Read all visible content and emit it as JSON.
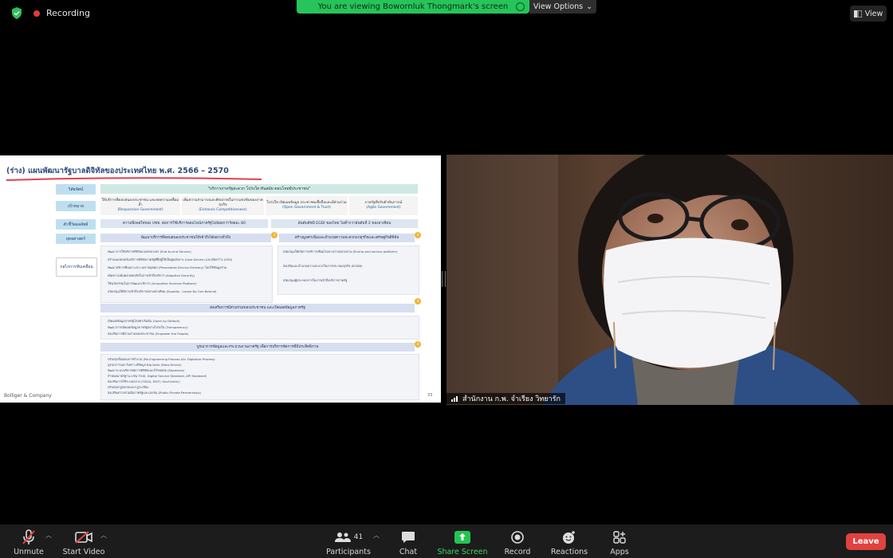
{
  "top": {
    "recording_label": "Recording",
    "banner_text": "You are viewing Bowornluk Thongmark's screen",
    "view_options_label": "View Options",
    "view_label": "View"
  },
  "slide": {
    "title": "(ร่าง) แผนพัฒนารัฐบาลดิจิทัลของประเทศไทย พ.ศ. 2566 – 2570",
    "labels": [
      "วิสัยทัศน์",
      "เป้าหมาย",
      "ตัวชี้วัดผลลัพธ์",
      "ยุทธศาสตร์",
      "กลไกการขับเคลื่อน"
    ],
    "vision": "\"บริการภาครัฐสะดวก โปร่งใส ทันสมัย ตอบโจทย์ประชาชน\"",
    "goals": [
      {
        "text": "ให้บริการที่ตอบสนองประชาชน และลดความเหลื่อมล้ำ",
        "en": "(Responsive Government)"
      },
      {
        "text": "เพิ่มความสามารถและศักยภาพในการแข่งขันของภาคธุรกิจ",
        "en": "(Enhance Competitiveness)"
      },
      {
        "text": "โปร่งใส เปิดเผยข้อมูล ประชาชนเชื่อถือและมีส่วนร่วม",
        "en": "(Open Government & Trust)"
      },
      {
        "text": "ภาครัฐที่ปรับตัวทันการณ์",
        "en": "(Agile Government)"
      }
    ],
    "indicators": [
      "ความพึงพอใจของ ปชช. ต่อการใช้บริการออนไลน์ภาครัฐไม่น้อยกว่าร้อยละ 80",
      "อันดับดัชนี EGDI ของไทย ไม่ต่ำกว่าอันดับที่ 2 ของอาเซียน"
    ],
    "strategies": [
      "พัฒนาบริการที่ตอบสนองประชาชนให้เข้าถึงได้อย่างทั่วถึง",
      "สร้างมูลค่าเพิ่มและอำนวยความสะดวกแก่ธุรกิจและเศรษฐกิจดิจิทัล",
      "ส่งเสริมการมีส่วนร่วมของประชาชน และเปิดเผยข้อมูลภาครัฐ",
      "บูรณาการข้อมูลและกระบวนงานภาครัฐ เพื่อการบริหารจัดการที่มีประสิทธิภาพ"
    ],
    "strategy_numbers": [
      "1",
      "2",
      "3",
      "4"
    ],
    "bullets": {
      "s1": [
        "พัฒนาการให้บริการดิจิทัลแบบครบวงจร (End-to-end Service)",
        "สร้างแพลตฟอร์มบริการดิจิทัลภาครัฐที่ยึดผู้ใช้เป็นศูนย์กลาง (User-Driven) และเปิดกว้าง (OSS)",
        "พัฒนาบริการที่เฉพาะเจาะจงรายบุคคล (Personalize Service Delivery) โดยใช้ข้อมูลร่วม",
        "เพิ่มความมั่นคงปลอดภัยในการเข้าถึงบริการ (Adaptive Security)",
        "ใช้นวัตกรรมในการพัฒนาบริการ (Innovative Services Platform)",
        "สนับสนุนให้มีการเข้าถึงบริการอย่างเท่าเทียม (Equality : Leave No One Behind)"
      ],
      "s2": [
        "สนับสนุนให้เกิดการบริการเชื่อมโยงระหว่างหน่วยงาน (End-to-end service platform)",
        "ส่งเสริมและอำนวยความสะดวกในการประกอบธุรกิจ (EODB)",
        "สนับสนุนผู้ประกอบการในการเข้าถึงบริการภาครัฐ"
      ],
      "s3": [
        "เปิดเผยข้อมูลภาครัฐโดยค่าเริ่มต้น (Open by Default)",
        "พัฒนาการเปิดเผยข้อมูลภาครัฐอย่างโปร่งใส (Transparency)",
        "ส่งเสริมการมีส่วนร่วมของประชาชน (Empower the People)"
      ],
      "s4": [
        "ปรับปรุงขั้นตอนการทำงาน (Re-Engineering Process และ Digitalize Process)",
        "บูรณาการและวิเคราะห์ข้อมูล Big Data (Data-Driven)",
        "พัฒนาระบบบริหารจัดการดิจิทัลแบบไร้รอยต่อ (Seamless)",
        "กำหนดมาตรฐาน (เช่น TGIX, Digital Service Standard, API Standard)",
        "ส่งเสริมการใช้ระบบกลาง (TDGA, DGFI, GovCentric)",
        "ปรับปรุงกฎหมายและกฎระเบียบ",
        "ส่งเสริมความร่วมมือภาครัฐและเอกชน (Public-Private Partnerships)"
      ]
    },
    "brand": "Bolliger & Company",
    "page_number": "33"
  },
  "camera": {
    "participant_name": "สำนักงาน ก.พ. จำเรียง วิทยารัก"
  },
  "toolbar": {
    "unmute": "Unmute",
    "start_video": "Start Video",
    "participants": "Participants",
    "participants_count": "41",
    "chat": "Chat",
    "share_screen": "Share Screen",
    "record": "Record",
    "reactions": "Reactions",
    "apps": "Apps",
    "leave": "Leave"
  },
  "colors": {
    "banner": "#26c45a",
    "share_accent": "#3fd45f",
    "leave": "#e0423f",
    "recording_dot": "#e23b3b"
  }
}
